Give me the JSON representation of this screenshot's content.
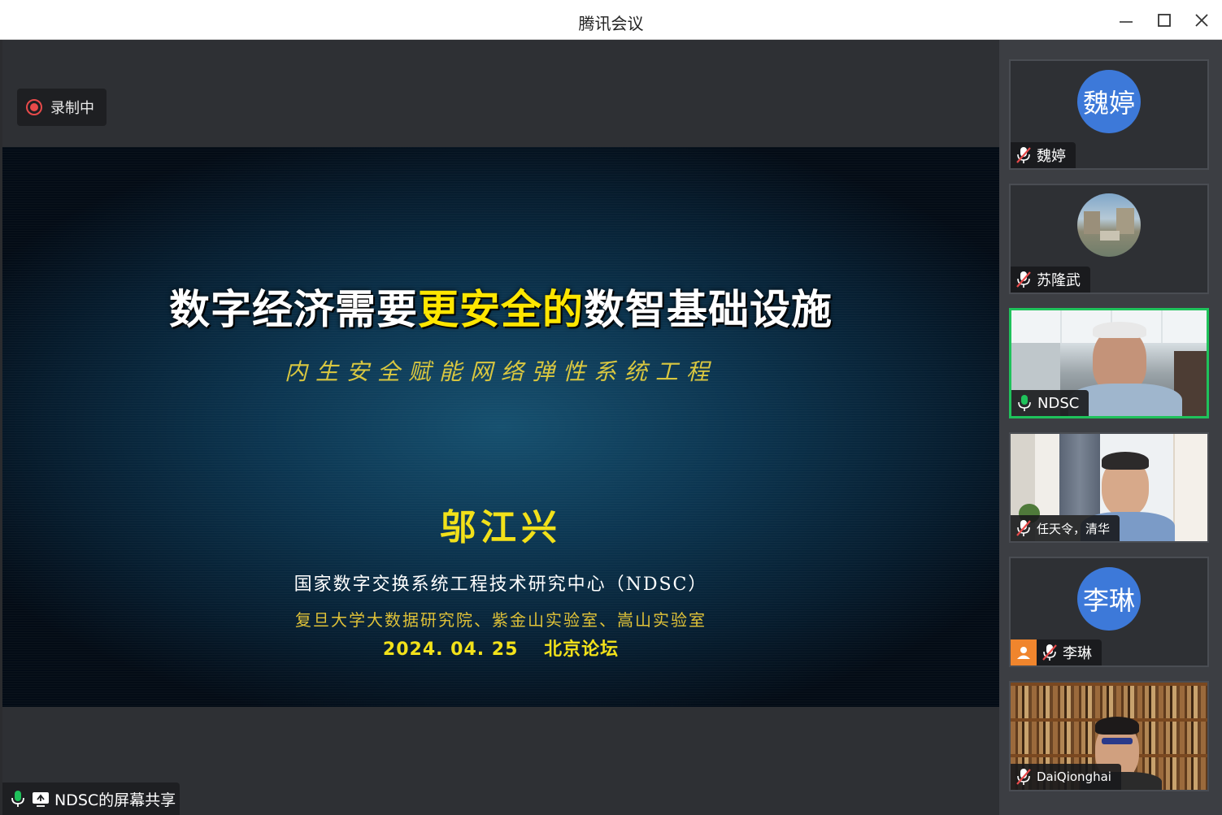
{
  "window": {
    "title": "腾讯会议"
  },
  "recording": {
    "label": "录制中"
  },
  "slide": {
    "title_before": "数字经济需要",
    "title_highlight": "更安全的",
    "title_after": "数智基础设施",
    "subtitle": "内生安全赋能网络弹性系统工程",
    "author": "邬江兴",
    "organization": "国家数字交换系统工程技术研究中心（NDSC）",
    "institutions": "复旦大学大数据研究院、紫金山实验室、嵩山实验室",
    "date_venue": "2024. 04. 25　 北京论坛"
  },
  "share": {
    "label": "NDSC的屏幕共享"
  },
  "participants": [
    {
      "name": "魏婷",
      "avatar_text": "魏婷",
      "mic": "muted",
      "video": "avatar"
    },
    {
      "name": "苏隆武",
      "mic": "muted",
      "video": "photo"
    },
    {
      "name": "NDSC",
      "mic": "active",
      "video": "camera",
      "speaking": true
    },
    {
      "name": "任天令，清华",
      "mic": "muted",
      "video": "camera"
    },
    {
      "name": "李琳",
      "avatar_text": "李琳",
      "mic": "muted",
      "video": "avatar",
      "badge": "user-icon"
    },
    {
      "name": "DaiQionghai",
      "mic": "muted",
      "video": "camera"
    }
  ],
  "colors": {
    "accent_green": "#1fc25b",
    "avatar_blue": "#3d79d9",
    "record_red": "#e84a4a",
    "highlight_yellow": "#ffe600"
  }
}
